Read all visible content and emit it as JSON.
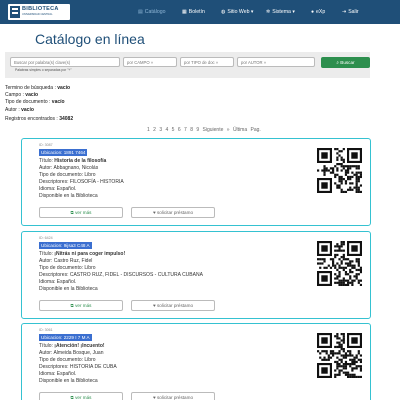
{
  "nav": {
    "logo_title": "BIBLIOTECA",
    "logo_subtitle": "UNIVERSIDAD CENTRAL",
    "items": [
      {
        "label": "Catálogo",
        "icon": "book-icon",
        "active": true
      },
      {
        "label": "Boletín",
        "icon": "boletin-icon",
        "active": false
      },
      {
        "label": "Sitio Web ▾",
        "icon": "globe-icon",
        "active": false
      },
      {
        "label": "Sistema ▾",
        "icon": "gear-icon",
        "active": false
      },
      {
        "label": "eXp",
        "icon": "user-icon",
        "active": false
      },
      {
        "label": "Salir",
        "icon": "logout-icon",
        "active": false
      }
    ]
  },
  "page_title": "Catálogo en línea",
  "search": {
    "keyword_placeholder": "Buscar por palabra(s) clave(s)",
    "field1": "por CAMPO »",
    "field2": "por TIPO de doc »",
    "field3": "por AUTOR »",
    "hint": "Palabras simples o separadas por \"+\"",
    "button": "Buscar"
  },
  "summary": {
    "term_label": "Termino de búsqueda :",
    "term_value": "vacío",
    "field_label": "Campo :",
    "field_value": "vacío",
    "doctype_label": "Tipo de documento :",
    "doctype_value": "vacío",
    "author_label": "Autor :",
    "author_value": "vacío",
    "records_label": "Registros encontrados :",
    "records_value": "34082"
  },
  "pager": "1 2 3 4 5 6 7 8 9 Siguiente » Última Pag.",
  "records": [
    {
      "id": "ID: 3087",
      "code": "Ubicacion: 1891 7464",
      "title_label": "Título:",
      "title": "Historia de la filosofía",
      "author": "Autor: Abbagnano, Nicolás",
      "doctype": "Tipo de documento: Libro",
      "descriptors": "Descriptores: FILOSOFÍA - HISTORIA",
      "language": "Idioma: Español.",
      "availability": "Disponible en la Biblioteca",
      "more": "ver más",
      "loan": "solicitar préstamo"
    },
    {
      "id": "ID: 6424",
      "code": "Ubicacion: 9ijsa3 C48 A",
      "title_label": "Título:",
      "title": "¡Nitrás ni para coger impulso!",
      "author": "Autor: Castro Ruz, Fidel",
      "doctype": "Tipo de documento: Libro",
      "descriptors": "Descriptores: CASTRO RUZ, FIDEL - DISCURSOS - CULTURA CUBANA",
      "language": "Idioma: Español.",
      "availability": "Disponible en la Biblioteca",
      "more": "ver más",
      "loan": "solicitar préstamo"
    },
    {
      "id": "ID: 3061",
      "code": "Ubicacion: 2229 I 7 M A",
      "title_label": "Título:",
      "title": "¡Atención! ¡Incuento!",
      "author": "Autor: Almeida Bosque, Juan",
      "doctype": "Tipo de documento: Libro",
      "descriptors": "Descriptores: HISTORIA DE CUBA",
      "language": "Idioma: Español.",
      "availability": "Disponible en la Biblioteca",
      "more": "ver más",
      "loan": "solicitar préstamo"
    }
  ],
  "colors": {
    "nav_bg": "#1f4f78",
    "accent_green": "#2d8f4e",
    "card_border": "#35c2d1",
    "code_highlight": "#3b6fd0"
  }
}
